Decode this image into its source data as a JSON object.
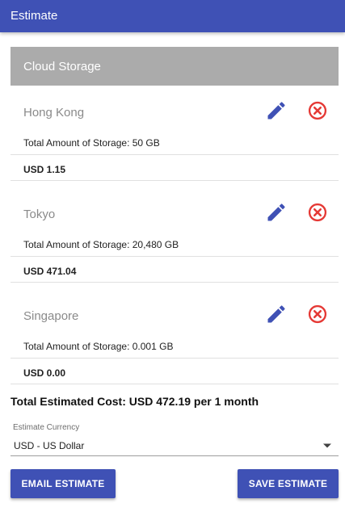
{
  "app": {
    "title": "Estimate"
  },
  "section": {
    "title": "Cloud Storage"
  },
  "regions": [
    {
      "name": "Hong Kong",
      "storage": "Total Amount of Storage: 50 GB",
      "cost": "USD 1.15"
    },
    {
      "name": "Tokyo",
      "storage": "Total Amount of Storage: 20,480 GB",
      "cost": "USD 471.04"
    },
    {
      "name": "Singapore",
      "storage": "Total Amount of Storage: 0.001 GB",
      "cost": "USD 0.00"
    }
  ],
  "icons": {
    "edit": "edit-pencil-icon",
    "remove": "remove-circle-x-icon",
    "dropdown": "dropdown-arrow-icon"
  },
  "total": {
    "text": "Total Estimated Cost: USD 472.19 per 1 month"
  },
  "currency": {
    "label": "Estimate Currency",
    "value": "USD - US Dollar"
  },
  "buttons": {
    "email": "EMAIL ESTIMATE",
    "save": "SAVE ESTIMATE"
  },
  "colors": {
    "primary": "#3f51b5",
    "header_gray": "#ababab",
    "remove_red": "#e53935"
  }
}
